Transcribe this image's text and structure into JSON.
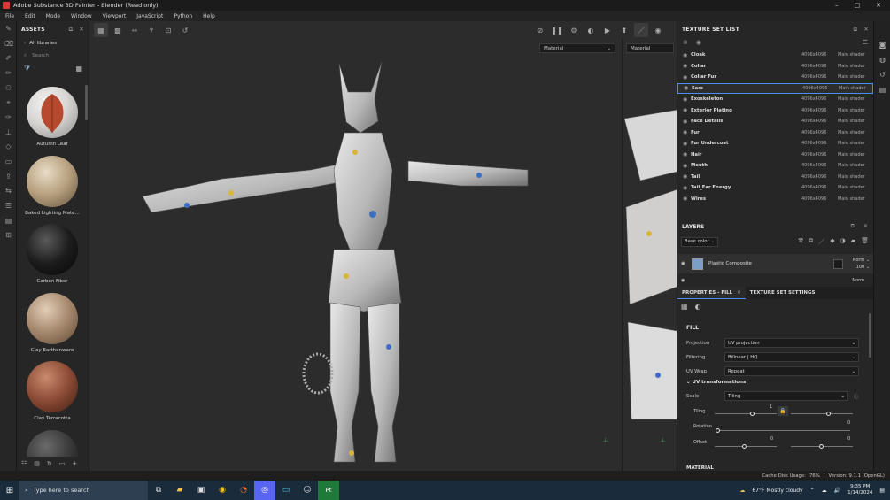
{
  "window": {
    "title": "Adobe Substance 3D Painter - Blender (Read only)",
    "controls": [
      "–",
      "□",
      "✕"
    ]
  },
  "menu": [
    "File",
    "Edit",
    "Mode",
    "Window",
    "Viewport",
    "JavaScript",
    "Python",
    "Help"
  ],
  "assets": {
    "header": "ASSETS",
    "library": "All libraries",
    "search_placeholder": "Search",
    "items": [
      {
        "label": "Autumn Leaf",
        "color": "#b54a2e"
      },
      {
        "label": "Baked Lighting Mate...",
        "color": "#b59e7c"
      },
      {
        "label": "Carbon Fiber",
        "color": "#1c1c1c"
      },
      {
        "label": "Clay Earthenware",
        "color": "#a4876b"
      },
      {
        "label": "Clay Terracotta",
        "color": "#8a4a34"
      },
      {
        "label": "",
        "color": "#3a3a3a"
      }
    ]
  },
  "viewport": {
    "left_select": "Material",
    "right_select": "Material"
  },
  "texture_set_list": {
    "header": "TEXTURE SET LIST",
    "rows": [
      {
        "name": "Cloak",
        "res": "4096x4096",
        "shader": "Main shader"
      },
      {
        "name": "Collar",
        "res": "4096x4096",
        "shader": "Main shader"
      },
      {
        "name": "Collar Fur",
        "res": "4096x4096",
        "shader": "Main shader"
      },
      {
        "name": "Ears",
        "res": "4096x4096",
        "shader": "Main shader",
        "selected": true
      },
      {
        "name": "Exoskeleton",
        "res": "4096x4096",
        "shader": "Main shader"
      },
      {
        "name": "Exterior Plating",
        "res": "4096x4096",
        "shader": "Main shader"
      },
      {
        "name": "Face Details",
        "res": "4096x4096",
        "shader": "Main shader"
      },
      {
        "name": "Fur",
        "res": "4096x4096",
        "shader": "Main shader"
      },
      {
        "name": "Fur Undercoat",
        "res": "4096x4096",
        "shader": "Main shader"
      },
      {
        "name": "Hair",
        "res": "4096x4096",
        "shader": "Main shader"
      },
      {
        "name": "Mouth",
        "res": "4096x4096",
        "shader": "Main shader"
      },
      {
        "name": "Tail",
        "res": "4096x4096",
        "shader": "Main shader"
      },
      {
        "name": "Tail_Ear Energy",
        "res": "4096x4096",
        "shader": "Main shader"
      },
      {
        "name": "Wires",
        "res": "4096x4096",
        "shader": "Main shader"
      }
    ]
  },
  "layers": {
    "header": "LAYERS",
    "channel": "Base color",
    "layer_name": "Plastic Composite",
    "blend_mode": "Norm",
    "opacity": "100",
    "second_blend": "Norm"
  },
  "properties": {
    "tab_fill": "PROPERTIES - FILL",
    "tab_settings": "TEXTURE SET SETTINGS",
    "section": "FILL",
    "projection_label": "Projection",
    "projection_value": "UV projection",
    "filtering_label": "Filtering",
    "filtering_value": "Bilinear | HQ",
    "uvwrap_label": "UV Wrap",
    "uvwrap_value": "Repeat",
    "uv_transformations": "UV transformations",
    "scale_label": "Scale",
    "scale_value": "Tiling",
    "tiling_label": "Tiling",
    "tiling_value": "1",
    "rotation_label": "Rotation",
    "rotation_value": "0",
    "offset_label": "Offset",
    "offset_x": "0",
    "offset_y": "0",
    "material_section": "MATERIAL"
  },
  "status": {
    "cache": "Cache Disk Usage:",
    "cache_pct": "76%",
    "version": "Version: 9.1.1 (OpenGL)"
  },
  "taskbar": {
    "search_placeholder": "Type here to search",
    "weather": "67°F  Mostly cloudy",
    "time": "9:35 PM",
    "date": "1/14/2024"
  }
}
